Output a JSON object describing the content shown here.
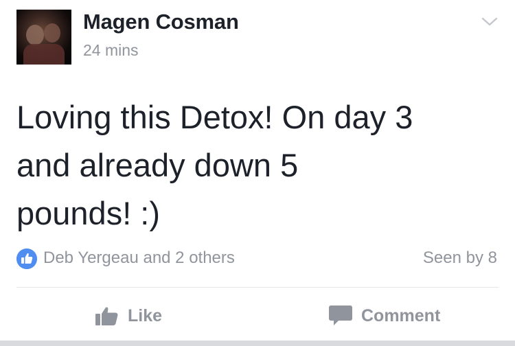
{
  "post": {
    "author": "Magen Cosman",
    "timestamp": "24 mins",
    "message_lines": [
      "Loving this Detox! On day 3",
      "and already down 5",
      "pounds! :)"
    ]
  },
  "reactions": {
    "summary": "Deb Yergeau and 2 others",
    "seen_by": "Seen by 8"
  },
  "actions": {
    "like_label": "Like",
    "comment_label": "Comment"
  },
  "icons": {
    "menu": "chevron-down-icon",
    "like_badge": "thumbs-up-icon",
    "like_action": "thumbs-up-icon",
    "comment_action": "comment-bubble-icon"
  },
  "colors": {
    "text_primary": "#1d2129",
    "text_secondary": "#90949c",
    "like_blue": "#4f8ef0",
    "divider": "#e5e5e5"
  }
}
